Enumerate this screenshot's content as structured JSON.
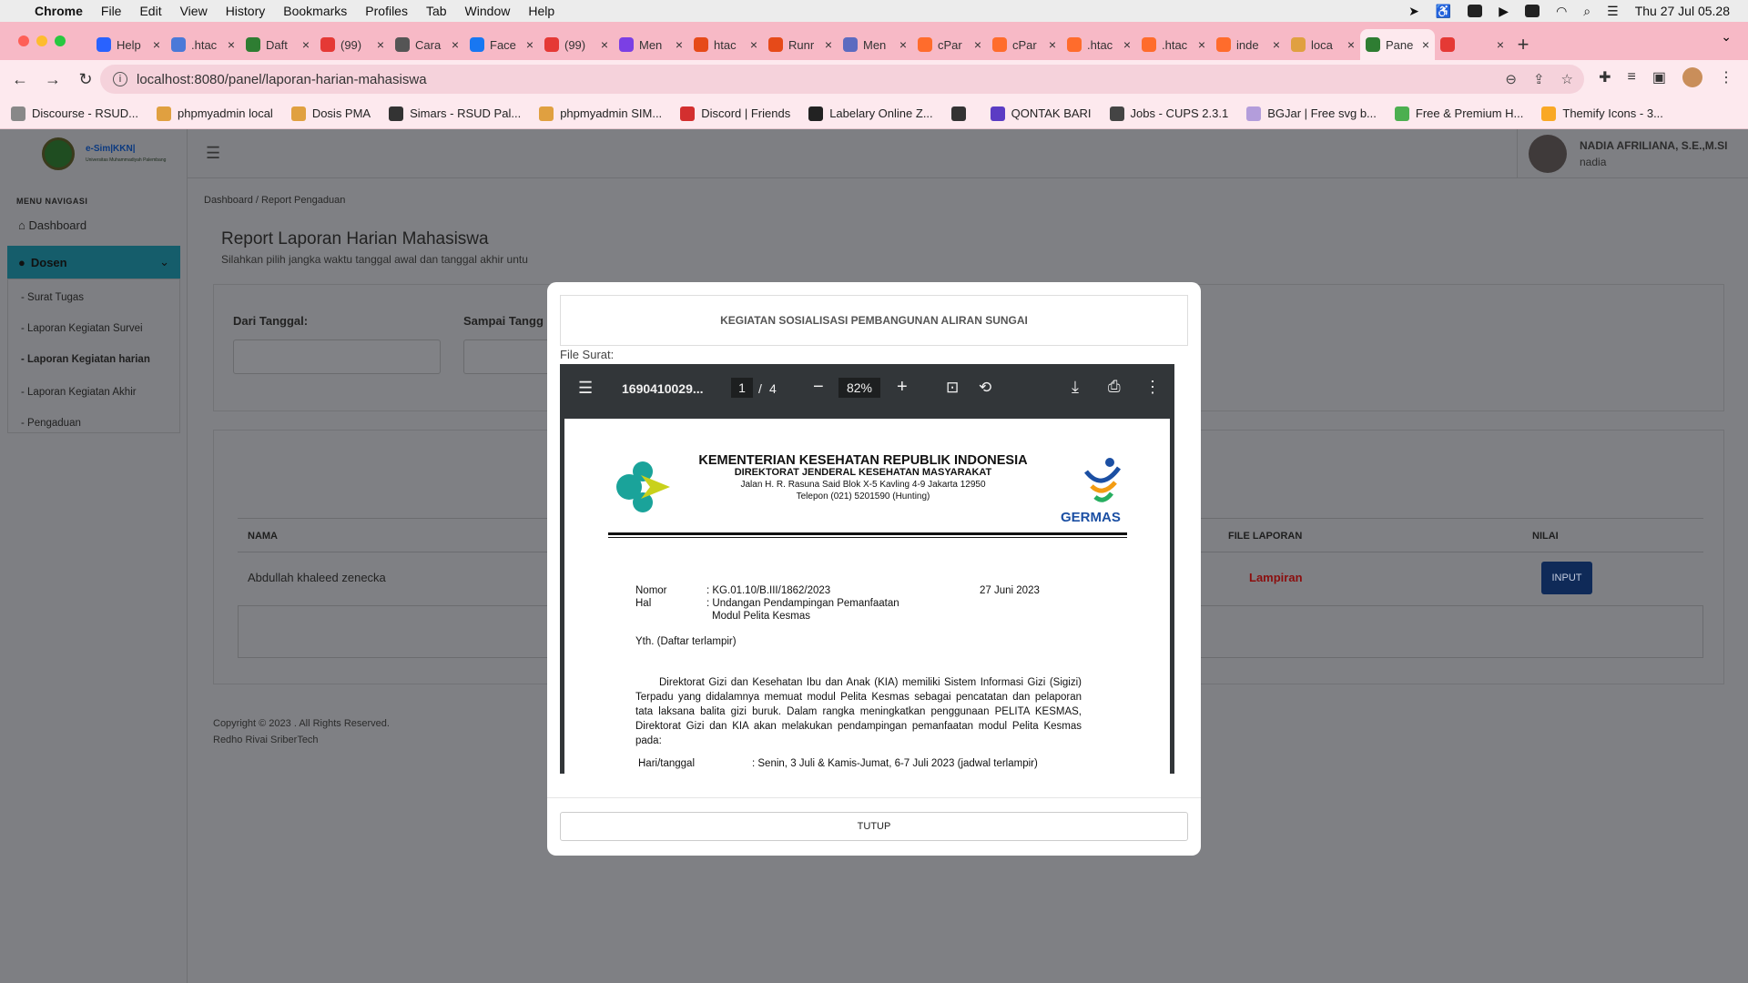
{
  "mac_menubar": {
    "app": "Chrome",
    "items": [
      "File",
      "Edit",
      "View",
      "History",
      "Bookmarks",
      "Profiles",
      "Tab",
      "Window",
      "Help"
    ],
    "clock": "Thu 27 Jul  05.28"
  },
  "tabs": [
    {
      "label": "Help",
      "color": "#2962ff"
    },
    {
      "label": ".htac",
      "color": "#4a79d8"
    },
    {
      "label": "Daft",
      "color": "#2e7d32"
    },
    {
      "label": "(99)",
      "color": "#e53935"
    },
    {
      "label": "Cara",
      "color": "#555555"
    },
    {
      "label": "Face",
      "color": "#1877f2"
    },
    {
      "label": "(99)",
      "color": "#e53935"
    },
    {
      "label": "Men",
      "color": "#7b3fe4"
    },
    {
      "label": "htac",
      "color": "#e64a19"
    },
    {
      "label": "Runr",
      "color": "#e64a19"
    },
    {
      "label": "Men",
      "color": "#5c6bc0"
    },
    {
      "label": "cPar",
      "color": "#ff6c2c"
    },
    {
      "label": "cPar",
      "color": "#ff6c2c"
    },
    {
      "label": ".htac",
      "color": "#ff6c2c"
    },
    {
      "label": ".htac",
      "color": "#ff6c2c"
    },
    {
      "label": "inde",
      "color": "#ff6c2c"
    },
    {
      "label": "loca",
      "color": "#e0a040"
    },
    {
      "label": "Pane",
      "color": "#2e7d32",
      "active": true
    },
    {
      "label": "",
      "color": "#e53935"
    }
  ],
  "address": {
    "url": "localhost:8080/panel/laporan-harian-mahasiswa"
  },
  "bookmarks": [
    {
      "label": "Discourse - RSUD...",
      "color": "#888888"
    },
    {
      "label": "phpmyadmin local",
      "color": "#e0a040"
    },
    {
      "label": "Dosis PMA",
      "color": "#e0a040"
    },
    {
      "label": "Simars - RSUD Pal...",
      "color": "#333333"
    },
    {
      "label": "phpmyadmin SIM...",
      "color": "#e0a040"
    },
    {
      "label": "Discord | Friends",
      "color": "#d32f2f"
    },
    {
      "label": "Labelary Online Z...",
      "color": "#222222"
    },
    {
      "label": "",
      "color": "#333333"
    },
    {
      "label": "QONTAK BARI",
      "color": "#5b3cc4"
    },
    {
      "label": "Jobs - CUPS 2.3.1",
      "color": "#444444"
    },
    {
      "label": "BGJar | Free svg b...",
      "color": "#b39ddb"
    },
    {
      "label": "Free & Premium H...",
      "color": "#4caf50"
    },
    {
      "label": "Themify Icons - 3...",
      "color": "#f9a825"
    }
  ],
  "app": {
    "logo_title": "e-Sim|KKN|",
    "logo_sub": "Universitas Muhammadiyah Palembang",
    "user_name": "NADIA AFRILIANA, S.E.,M.SI",
    "user_handle": "nadia",
    "menu_title": "MENU NAVIGASI",
    "dashboard": "Dashboard",
    "dosen": "Dosen",
    "submenu": [
      "- Surat Tugas",
      "- Laporan Kegiatan Survei",
      "- Laporan Kegiatan harian",
      "- Laporan Kegiatan Akhir",
      "- Pengaduan"
    ],
    "breadcrumb": "Dashboard  /  Report Pengaduan",
    "page_title": "Report Laporan Harian Mahasiswa",
    "page_subtitle": "Silahkan pilih jangka waktu tanggal awal dan tanggal akhir untu",
    "dari_label": "Dari Tanggal:",
    "sampai_label": "Sampai Tangg",
    "col_nama": "NAMA",
    "col_file": "FILE LAPORAN",
    "col_nilai": "NILAI",
    "row_name": "Abdullah khaleed zenecka",
    "row_file": "Lampiran",
    "row_button": "INPUT",
    "copyright": "Copyright © 2023 . All Rights Reserved.",
    "credit": "Redho Rivai SriberTech"
  },
  "modal": {
    "title": "KEGIATAN SOSIALISASI PEMBANGUNAN ALIRAN SUNGAI",
    "file_label": "File Surat:",
    "close": "TUTUP",
    "pdf": {
      "filename": "1690410029...",
      "page": "1",
      "page_sep": "/",
      "total": "4",
      "zoom": "82%",
      "ministry": "KEMENTERIAN KESEHATAN REPUBLIK INDONESIA",
      "directorate": "DIREKTORAT JENDERAL KESEHATAN MASYARAKAT",
      "address": "Jalan H. R. Rasuna Said Blok X-5 Kavling 4-9 Jakarta 12950",
      "phone": "Telepon (021) 5201590 (Hunting)",
      "germas": "GERMAS",
      "nomor_label": "Nomor",
      "nomor": ": KG.01.10/B.III/1862/2023",
      "date": "27 Juni 2023",
      "hal_label": "Hal",
      "hal1": ": Undangan Pendampingan Pemanfaatan",
      "hal2": "Modul Pelita Kesmas",
      "yth": "Yth. (Daftar terlampir)",
      "paragraph": "Direktorat Gizi dan Kesehatan Ibu dan Anak (KIA) memiliki Sistem Informasi Gizi (Sigizi) Terpadu yang didalamnya memuat modul Pelita Kesmas sebagai pencatatan dan pelaporan tata laksana balita gizi buruk. Dalam rangka meningkatkan penggunaan PELITA KESMAS, Direktorat Gizi dan KIA akan melakukan pendampingan pemanfaatan modul Pelita Kesmas pada:",
      "hari_label": "Hari/tanggal",
      "hari": ": Senin, 3 Juli & Kamis-Jumat, 6-7 Juli 2023 (jadwal terlampir)"
    }
  }
}
